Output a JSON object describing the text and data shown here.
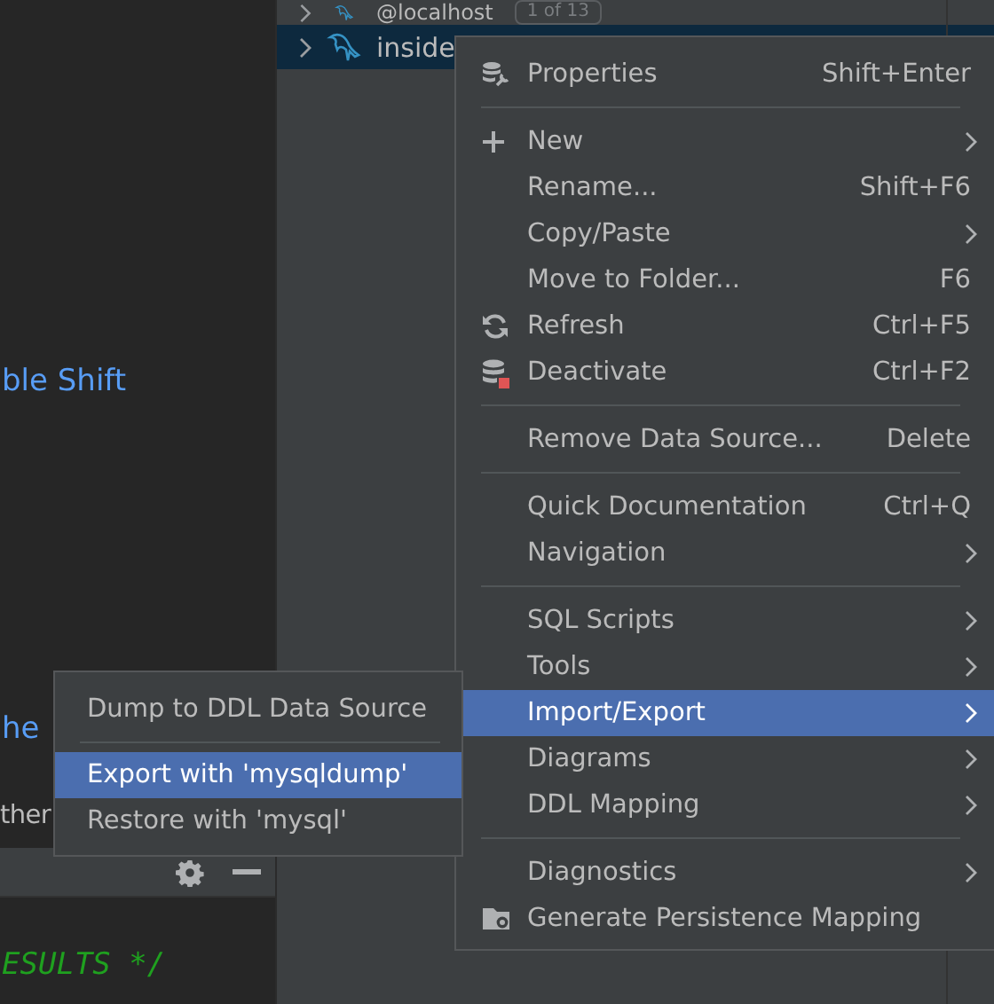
{
  "editor": {
    "lines": [
      {
        "text": "ble Shift",
        "kind": "link"
      },
      {
        "text": "he",
        "kind": "link"
      },
      {
        "text": "ther",
        "kind": "plain"
      }
    ],
    "code": "ESULTS */"
  },
  "tree": {
    "rows": [
      {
        "label": "@localhost",
        "badge": "1 of 13",
        "selected": false
      },
      {
        "label": "inside",
        "selected": true
      }
    ]
  },
  "context_menu": {
    "items": [
      {
        "kind": "wrench",
        "label": "Properties",
        "shortcut": "Shift+Enter",
        "submenu": false,
        "selected": false
      },
      {
        "kind": "separator"
      },
      {
        "kind": "add",
        "label": "New",
        "submenu": true,
        "selected": false
      },
      {
        "kind": "item",
        "label": "Rename...",
        "shortcut": "Shift+F6",
        "submenu": false,
        "selected": false
      },
      {
        "kind": "item",
        "label": "Copy/Paste",
        "submenu": true,
        "selected": false
      },
      {
        "kind": "item",
        "label": "Move to Folder...",
        "shortcut": "F6",
        "submenu": false,
        "selected": false
      },
      {
        "kind": "refresh",
        "label": "Refresh",
        "shortcut": "Ctrl+F5",
        "submenu": false,
        "selected": false
      },
      {
        "kind": "deactivate",
        "label": "Deactivate",
        "shortcut": "Ctrl+F2",
        "submenu": false,
        "selected": false
      },
      {
        "kind": "separator"
      },
      {
        "kind": "item",
        "label": "Remove Data Source...",
        "shortcut": "Delete",
        "submenu": false,
        "selected": false
      },
      {
        "kind": "separator"
      },
      {
        "kind": "item",
        "label": "Quick Documentation",
        "shortcut": "Ctrl+Q",
        "submenu": false,
        "selected": false
      },
      {
        "kind": "item",
        "label": "Navigation",
        "submenu": true,
        "selected": false
      },
      {
        "kind": "separator"
      },
      {
        "kind": "item",
        "label": "SQL Scripts",
        "submenu": true,
        "selected": false
      },
      {
        "kind": "item",
        "label": "Tools",
        "submenu": true,
        "selected": false
      },
      {
        "kind": "item",
        "label": "Import/Export",
        "submenu": true,
        "selected": true
      },
      {
        "kind": "item",
        "label": "Diagrams",
        "submenu": true,
        "selected": false
      },
      {
        "kind": "item",
        "label": "DDL Mapping",
        "submenu": true,
        "selected": false
      },
      {
        "kind": "separator"
      },
      {
        "kind": "item",
        "label": "Diagnostics",
        "submenu": true,
        "selected": false
      },
      {
        "kind": "mapping",
        "label": "Generate Persistence Mapping",
        "submenu": false,
        "selected": false
      }
    ]
  },
  "submenu": {
    "items": [
      {
        "kind": "item",
        "label": "Dump to DDL Data Source",
        "selected": false
      },
      {
        "kind": "separator"
      },
      {
        "kind": "item",
        "label": "Export with 'mysqldump'",
        "selected": true
      },
      {
        "kind": "item",
        "label": "Restore with 'mysql'",
        "selected": false
      }
    ]
  }
}
